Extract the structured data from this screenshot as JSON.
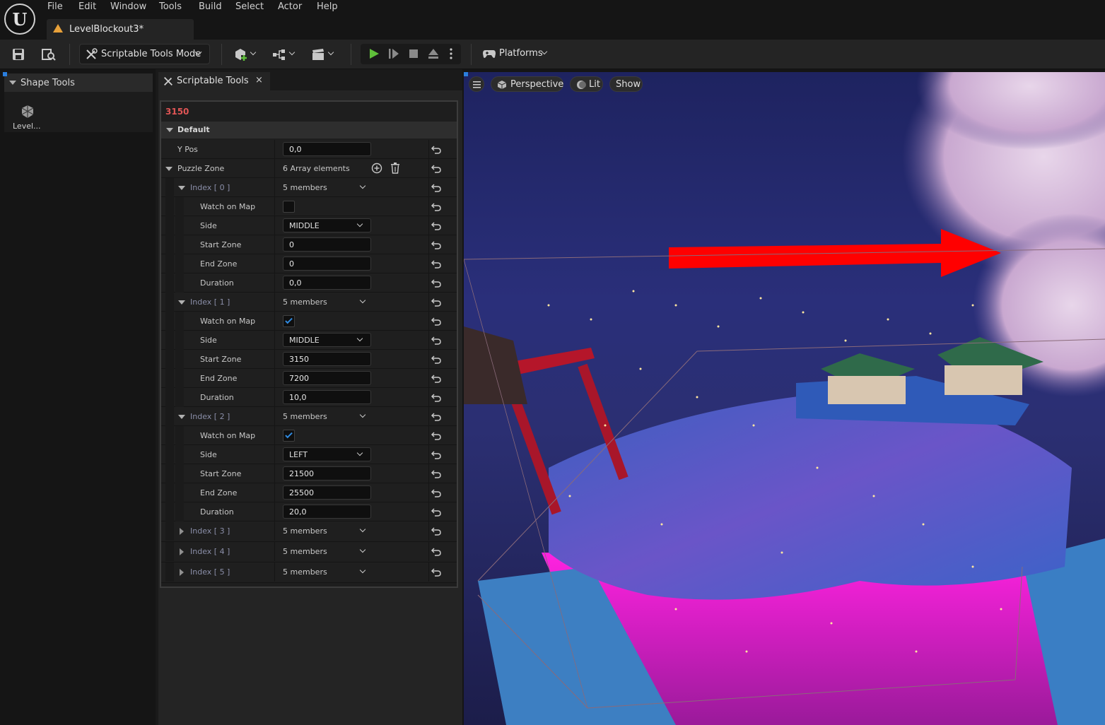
{
  "menu": [
    "File",
    "Edit",
    "Window",
    "Tools",
    "Build",
    "Select",
    "Actor",
    "Help"
  ],
  "document_tab": "LevelBlockout3*",
  "toolbar": {
    "mode_label": "Scriptable Tools Mode",
    "platforms_label": "Platforms"
  },
  "left_panel": {
    "section_title": "Shape Tools",
    "item_label": "Level..."
  },
  "details": {
    "tab_label": "Scriptable Tools",
    "close": "×",
    "object_name": "3150",
    "category": "Default",
    "ypos": {
      "label": "Y Pos",
      "value": "0,0"
    },
    "puzzle_zone": {
      "label": "Puzzle Zone",
      "summary": "6 Array elements"
    },
    "indices": [
      {
        "label": "Index [ 0 ]",
        "members": "5 members",
        "watch_label": "Watch on Map",
        "watch": false,
        "side_label": "Side",
        "side": "MIDDLE",
        "start_label": "Start Zone",
        "start": "0",
        "end_label": "End Zone",
        "end": "0",
        "duration_label": "Duration",
        "duration": "0,0"
      },
      {
        "label": "Index [ 1 ]",
        "members": "5 members",
        "watch_label": "Watch on Map",
        "watch": true,
        "side_label": "Side",
        "side": "MIDDLE",
        "start_label": "Start Zone",
        "start": "3150",
        "end_label": "End Zone",
        "end": "7200",
        "duration_label": "Duration",
        "duration": "10,0"
      },
      {
        "label": "Index [ 2 ]",
        "members": "5 members",
        "watch_label": "Watch on Map",
        "watch": true,
        "side_label": "Side",
        "side": "LEFT",
        "start_label": "Start Zone",
        "start": "21500",
        "end_label": "End Zone",
        "end": "25500",
        "duration_label": "Duration",
        "duration": "20,0"
      },
      {
        "label": "Index [ 3 ]",
        "members": "5 members"
      },
      {
        "label": "Index [ 4 ]",
        "members": "5 members"
      },
      {
        "label": "Index [ 5 ]",
        "members": "5 members"
      }
    ]
  },
  "viewport": {
    "perspective": "Perspective",
    "lit": "Lit",
    "show": "Show"
  },
  "colors": {
    "accent_blue": "#2b7fde",
    "play_green": "#5fbf3a",
    "object_name_red": "#e05555",
    "tab_warning_orange": "#e8a13a"
  }
}
